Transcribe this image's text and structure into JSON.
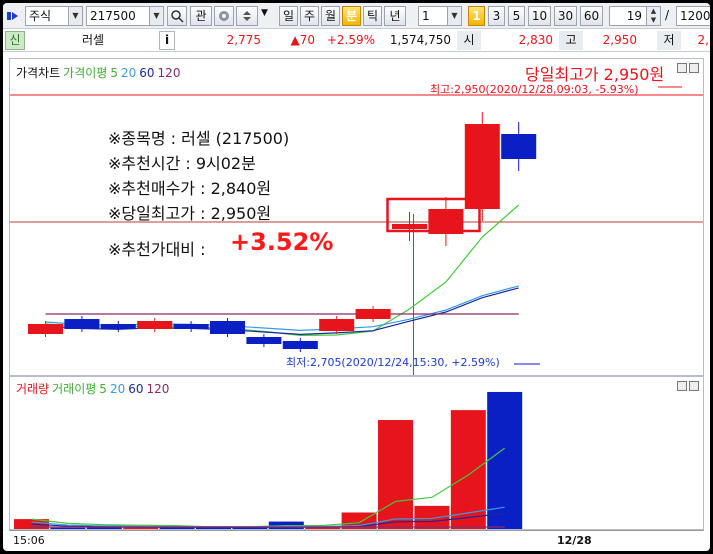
{
  "toolbar": {
    "market": "주식",
    "code": "217500",
    "search_icon": "magnifier-icon",
    "gwan_label": "관",
    "periods": [
      "일",
      "주",
      "월",
      "분",
      "틱",
      "년"
    ],
    "active_period": "분",
    "interval_value": "1",
    "intervals": [
      "1",
      "3",
      "5",
      "10",
      "30",
      "60"
    ],
    "count_value": "19",
    "slash": "/",
    "total_value": "1200"
  },
  "quote": {
    "tag": "신",
    "name": "러셀",
    "info_icon": "i",
    "price": "2,775",
    "change": "▲70",
    "change_pct": "+2.59%",
    "volume": "1,574,750",
    "open_label": "시",
    "open": "2,830",
    "high_label": "고",
    "high": "2,950",
    "low_label": "저",
    "low": "2,"
  },
  "price_pane": {
    "legend_main": "가격차트",
    "legend_ma_label": "가격이평",
    "legend_ma": [
      "5",
      "20",
      "60",
      "120"
    ],
    "headline": "당일최고가 2,950원",
    "high_note": "최고:2,950(2020/12/28,09:03, -5.93%)",
    "low_note": "최저:2,705(2020/12/24,15:30, +2.59%)",
    "notes": [
      "※종목명 : 러셀 (217500)",
      "※추천시간 : 9시02분",
      "※추천매수가 : 2,840원",
      "※당일최고가 : 2,950원"
    ],
    "ratio_label": "※추천가대비 :",
    "ratio_value": "+3.52%"
  },
  "volume_pane": {
    "legend_main": "거래량",
    "legend_ma_label": "거래이평",
    "legend_ma": [
      "5",
      "20",
      "60",
      "120"
    ]
  },
  "x_axis": {
    "left_label": "15:06",
    "date_label": "12/28"
  },
  "colors": {
    "up": "#e8141c",
    "down": "#0a1fc4",
    "ma5": "#44c83a",
    "ma20": "#3a9ae0",
    "ma60": "#1a2a9a",
    "ma120": "#8a2a6a"
  },
  "chart_data": {
    "type": "candlestick",
    "candles": [
      {
        "open": 2725,
        "close": 2735
      },
      {
        "open": 2740,
        "close": 2730
      },
      {
        "open": 2735,
        "close": 2730
      },
      {
        "open": 2730,
        "close": 2738
      },
      {
        "open": 2735,
        "close": 2730
      },
      {
        "open": 2738,
        "close": 2725
      },
      {
        "open": 2722,
        "close": 2715
      },
      {
        "open": 2718,
        "close": 2710
      },
      {
        "open": 2728,
        "close": 2740
      },
      {
        "open": 2740,
        "close": 2750
      },
      {
        "open": 2830,
        "close": 2835
      },
      {
        "open": 2825,
        "close": 2850
      },
      {
        "open": 2850,
        "close": 2935
      },
      {
        "open": 2925,
        "close": 2900
      }
    ],
    "volumes": [
      60,
      8,
      10,
      12,
      14,
      18,
      14,
      45,
      14,
      100,
      660,
      140,
      720,
      830
    ],
    "price_range": [
      2700,
      2960
    ],
    "volume_range": [
      0,
      860
    ]
  }
}
